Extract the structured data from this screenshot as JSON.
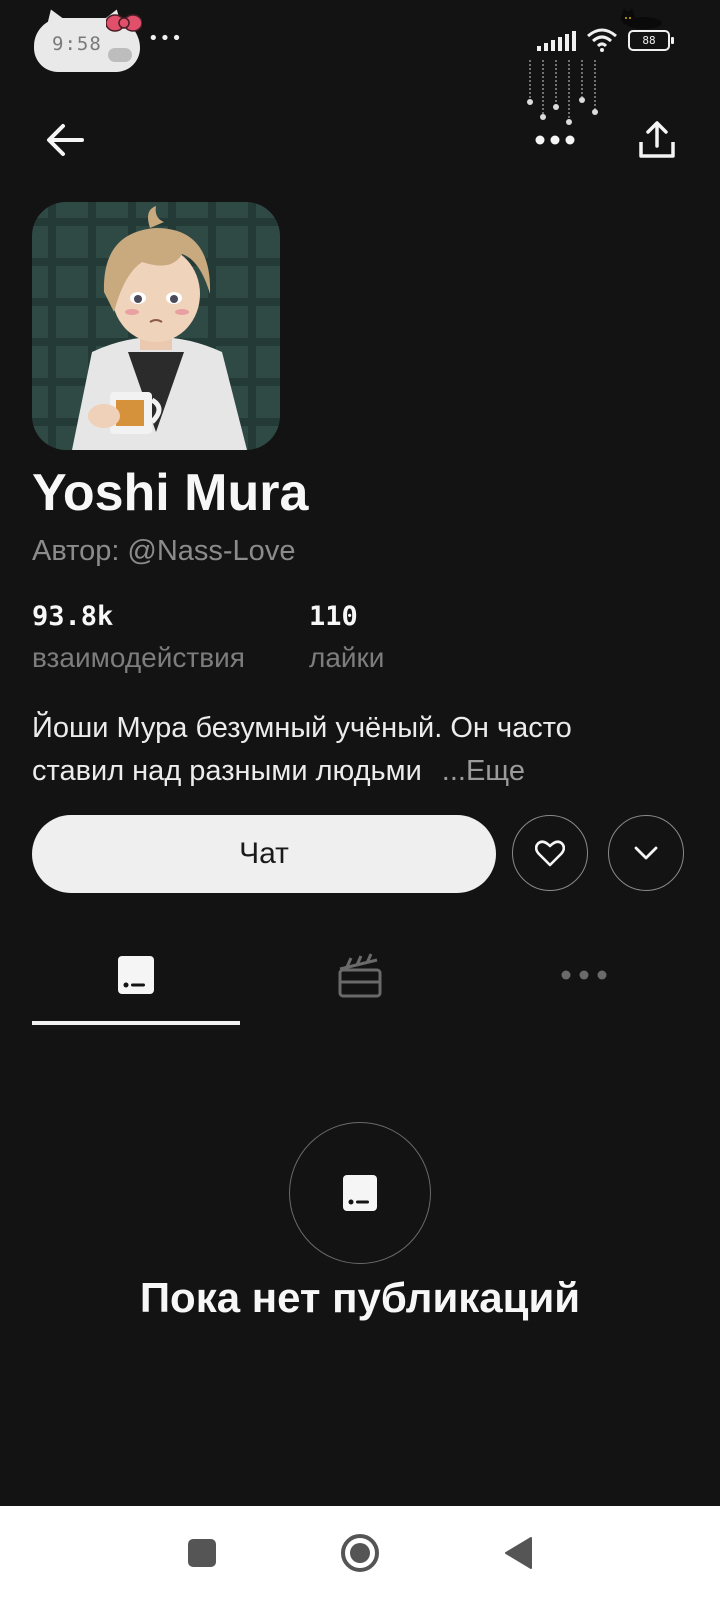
{
  "status_bar": {
    "time": "9:58",
    "battery": "88",
    "notification_dots": "•••"
  },
  "profile": {
    "name": "Yoshi Mura",
    "author_prefix": "Автор:",
    "author_handle": "@Nass-Love",
    "stats": [
      {
        "value": "93.8k",
        "label": "взаимодействия"
      },
      {
        "value": "110",
        "label": "лайки"
      }
    ],
    "description_lines": [
      "Йоши Мура безумный учёный. Он часто",
      "ставил над разными людьми"
    ],
    "more_label": "...Еще"
  },
  "actions": {
    "chat_label": "Чат"
  },
  "tabs": [
    {
      "icon": "posts-icon",
      "active": true
    },
    {
      "icon": "clapperboard-icon",
      "active": false
    },
    {
      "icon": "more-dots-icon",
      "active": false
    }
  ],
  "empty_state": {
    "message": "Пока нет публикаций"
  },
  "icons": {
    "back": "arrow-left-icon",
    "more": "more-dots-icon",
    "share": "share-icon",
    "like": "heart-icon",
    "expand": "chevron-down-icon"
  },
  "colors": {
    "background": "#131313",
    "chat_button": "#efefef",
    "muted_text": "#8b8b8b"
  }
}
